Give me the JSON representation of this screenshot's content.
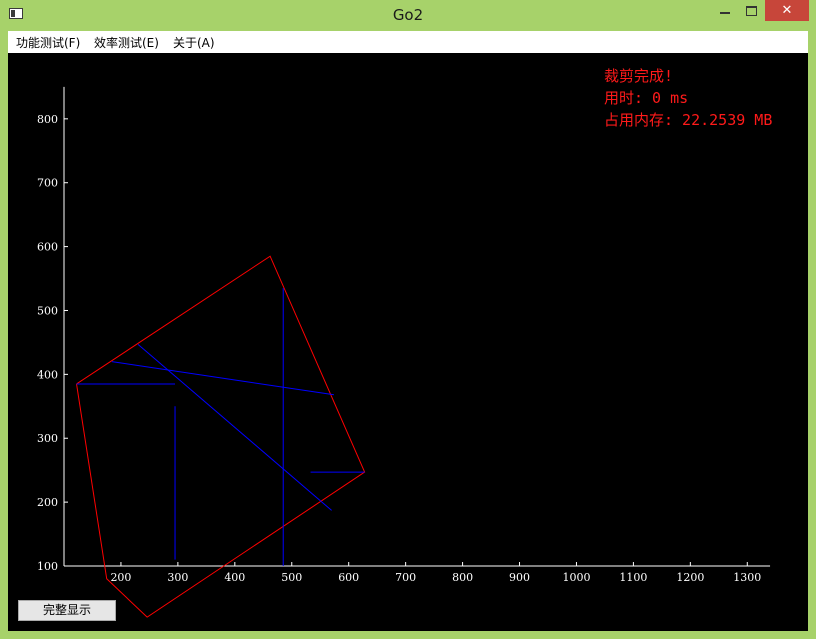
{
  "window": {
    "title": "Go2"
  },
  "menu": {
    "items": [
      "功能测试(F)",
      "效率测试(E)",
      "关于(A)"
    ]
  },
  "status": {
    "lines": [
      "裁剪完成!",
      "用时: 0 ms",
      "占用内存: 22.2539 MB"
    ]
  },
  "button": {
    "full_display": "完整显示"
  },
  "colors": {
    "background": "#000000",
    "polygon": "#ff0000",
    "segments": "#0000ff",
    "axis": "#ffffff",
    "status_text": "#ff1a1a"
  },
  "chart_data": {
    "type": "line",
    "xlim": [
      100,
      1340
    ],
    "ylim": [
      100,
      850
    ],
    "xticks": [
      200,
      300,
      400,
      500,
      600,
      700,
      800,
      900,
      1000,
      1100,
      1200,
      1300
    ],
    "yticks": [
      100,
      200,
      300,
      400,
      500,
      600,
      700,
      800
    ],
    "clip_polygon": [
      [
        122,
        385
      ],
      [
        462,
        585
      ],
      [
        628,
        247
      ],
      [
        246,
        20
      ],
      [
        175,
        80
      ],
      [
        122,
        385
      ]
    ],
    "segments": [
      [
        [
          122,
          385
        ],
        [
          295,
          385
        ]
      ],
      [
        [
          295,
          350
        ],
        [
          295,
          110
        ]
      ],
      [
        [
          184,
          420
        ],
        [
          574,
          368
        ]
      ],
      [
        [
          230,
          447
        ],
        [
          570,
          187
        ]
      ],
      [
        [
          485,
          535
        ],
        [
          485,
          100
        ]
      ],
      [
        [
          533,
          247
        ],
        [
          628,
          247
        ]
      ]
    ]
  }
}
